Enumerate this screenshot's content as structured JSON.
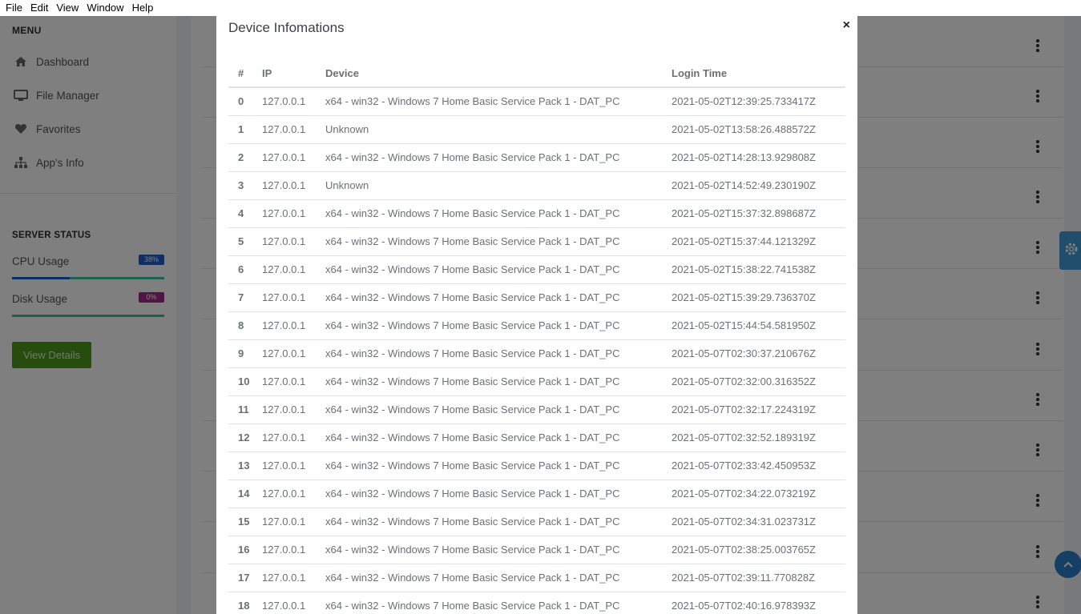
{
  "menubar": [
    "File",
    "Edit",
    "View",
    "Window",
    "Help"
  ],
  "sidebar": {
    "menu_heading": "MENU",
    "items": [
      {
        "label": "Dashboard",
        "icon": "home-icon"
      },
      {
        "label": "File Manager",
        "icon": "monitor-icon"
      },
      {
        "label": "Favorites",
        "icon": "heart-icon"
      },
      {
        "label": "App's Info",
        "icon": "sitemap-icon"
      }
    ],
    "status_heading": "SERVER STATUS",
    "cpu": {
      "label": "CPU Usage",
      "percent_text": "38%",
      "percent": 38,
      "color": "#1e5fc6"
    },
    "disk": {
      "label": "Disk Usage",
      "percent_text": "0%",
      "percent": 0,
      "color": "#a02a8a"
    },
    "view_details": "View Details"
  },
  "modal": {
    "title": "Device Infomations",
    "close": "×",
    "columns": [
      "#",
      "IP",
      "Device",
      "Login Time"
    ],
    "rows": [
      [
        "0",
        "127.0.0.1",
        "x64 - win32 - Windows 7 Home Basic Service Pack 1 - DAT_PC",
        "2021-05-02T12:39:25.733417Z"
      ],
      [
        "1",
        "127.0.0.1",
        "Unknown",
        "2021-05-02T13:58:26.488572Z"
      ],
      [
        "2",
        "127.0.0.1",
        "x64 - win32 - Windows 7 Home Basic Service Pack 1 - DAT_PC",
        "2021-05-02T14:28:13.929808Z"
      ],
      [
        "3",
        "127.0.0.1",
        "Unknown",
        "2021-05-02T14:52:49.230190Z"
      ],
      [
        "4",
        "127.0.0.1",
        "x64 - win32 - Windows 7 Home Basic Service Pack 1 - DAT_PC",
        "2021-05-02T15:37:32.898687Z"
      ],
      [
        "5",
        "127.0.0.1",
        "x64 - win32 - Windows 7 Home Basic Service Pack 1 - DAT_PC",
        "2021-05-02T15:37:44.121329Z"
      ],
      [
        "6",
        "127.0.0.1",
        "x64 - win32 - Windows 7 Home Basic Service Pack 1 - DAT_PC",
        "2021-05-02T15:38:22.741538Z"
      ],
      [
        "7",
        "127.0.0.1",
        "x64 - win32 - Windows 7 Home Basic Service Pack 1 - DAT_PC",
        "2021-05-02T15:39:29.736370Z"
      ],
      [
        "8",
        "127.0.0.1",
        "x64 - win32 - Windows 7 Home Basic Service Pack 1 - DAT_PC",
        "2021-05-02T15:44:54.581950Z"
      ],
      [
        "9",
        "127.0.0.1",
        "x64 - win32 - Windows 7 Home Basic Service Pack 1 - DAT_PC",
        "2021-05-07T02:30:37.210676Z"
      ],
      [
        "10",
        "127.0.0.1",
        "x64 - win32 - Windows 7 Home Basic Service Pack 1 - DAT_PC",
        "2021-05-07T02:32:00.316352Z"
      ],
      [
        "11",
        "127.0.0.1",
        "x64 - win32 - Windows 7 Home Basic Service Pack 1 - DAT_PC",
        "2021-05-07T02:32:17.224319Z"
      ],
      [
        "12",
        "127.0.0.1",
        "x64 - win32 - Windows 7 Home Basic Service Pack 1 - DAT_PC",
        "2021-05-07T02:32:52.189319Z"
      ],
      [
        "13",
        "127.0.0.1",
        "x64 - win32 - Windows 7 Home Basic Service Pack 1 - DAT_PC",
        "2021-05-07T02:33:42.450953Z"
      ],
      [
        "14",
        "127.0.0.1",
        "x64 - win32 - Windows 7 Home Basic Service Pack 1 - DAT_PC",
        "2021-05-07T02:34:22.073219Z"
      ],
      [
        "15",
        "127.0.0.1",
        "x64 - win32 - Windows 7 Home Basic Service Pack 1 - DAT_PC",
        "2021-05-07T02:34:31.023731Z"
      ],
      [
        "16",
        "127.0.0.1",
        "x64 - win32 - Windows 7 Home Basic Service Pack 1 - DAT_PC",
        "2021-05-07T02:38:25.003765Z"
      ],
      [
        "17",
        "127.0.0.1",
        "x64 - win32 - Windows 7 Home Basic Service Pack 1 - DAT_PC",
        "2021-05-07T02:39:11.770828Z"
      ],
      [
        "18",
        "127.0.0.1",
        "x64 - win32 - Windows 7 Home Basic Service Pack 1 - DAT_PC",
        "2021-05-07T02:40:16.978393Z"
      ]
    ]
  }
}
